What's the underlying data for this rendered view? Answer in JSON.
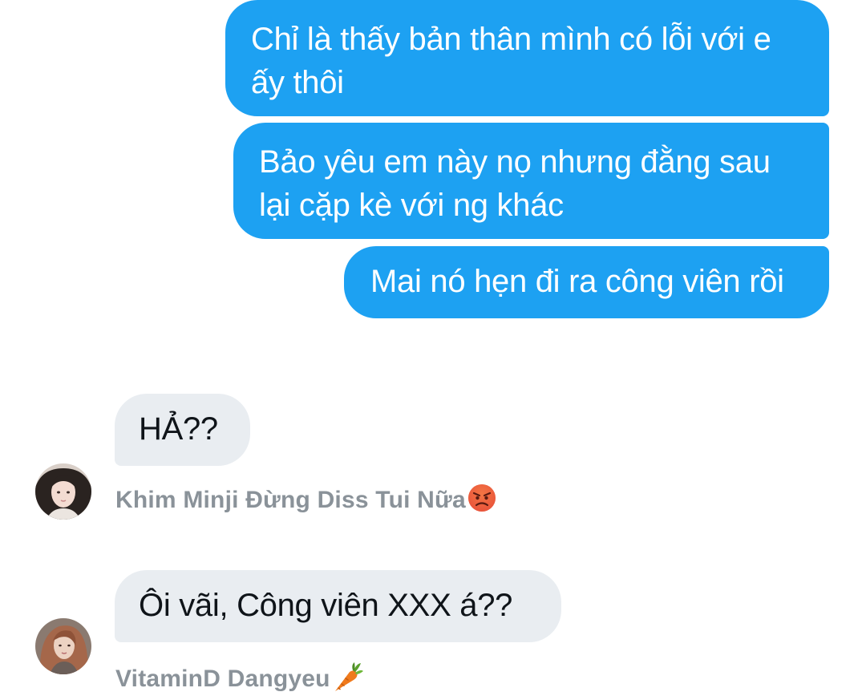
{
  "conversation": {
    "outgoing": [
      {
        "text": "Chỉ là thấy bản thân mình có lỗi với e ấy thôi"
      },
      {
        "text": "Bảo yêu em này nọ nhưng đằng sau lại cặp kè với ng khác"
      },
      {
        "text": "Mai nó hẹn đi ra công viên rồi"
      }
    ],
    "incoming": [
      {
        "text": "HẢ??",
        "sender": "Khim Minji Đừng Diss Tui Nữa",
        "sender_emoji_icon": "angry-face-icon",
        "avatar_icon": "avatar-icon"
      },
      {
        "text": "Ôi vãi, Công viên XXX á??",
        "sender": "VitaminD Dangyeu",
        "sender_emoji_icon": "carrot-icon",
        "avatar_icon": "avatar-icon"
      }
    ]
  },
  "colors": {
    "outgoing_bubble": "#1da1f2",
    "incoming_bubble": "#e9edf1",
    "sender_name": "#8a9299"
  }
}
